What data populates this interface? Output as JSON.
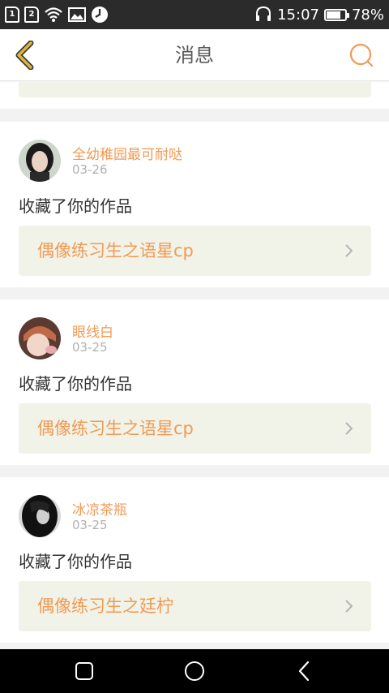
{
  "status_bar": {
    "sim1": "1",
    "sim2": "2",
    "time": "15:07",
    "battery_percent": "78%",
    "battery_level": 0.78,
    "icons": [
      "sim1-icon",
      "sim2-icon",
      "wifi-icon",
      "image-icon",
      "clock-app-icon",
      "headset-icon",
      "battery-icon"
    ]
  },
  "header": {
    "title": "消息",
    "back_icon": "back-chevron-icon",
    "search_icon": "search-icon"
  },
  "colors": {
    "accent": "#f19a55",
    "back_icon": "#e2b43a",
    "card_link_bg": "#f1f3e8",
    "text_primary": "#333333",
    "text_secondary": "#b0b0b0"
  },
  "messages": [
    {
      "username": "全幼稚园最可耐哒",
      "date": "03-26",
      "action": "收藏了你的作品",
      "work_title": "偶像练习生之语星cp"
    },
    {
      "username": "眼线白",
      "date": "03-25",
      "action": "收藏了你的作品",
      "work_title": "偶像练习生之语星cp"
    },
    {
      "username": "冰凉茶瓶",
      "date": "03-25",
      "action": "收藏了你的作品",
      "work_title": "偶像练习生之廷柠"
    }
  ],
  "nav_bar": {
    "icons": [
      "recents-square-icon",
      "home-circle-icon",
      "back-triangle-icon"
    ]
  }
}
